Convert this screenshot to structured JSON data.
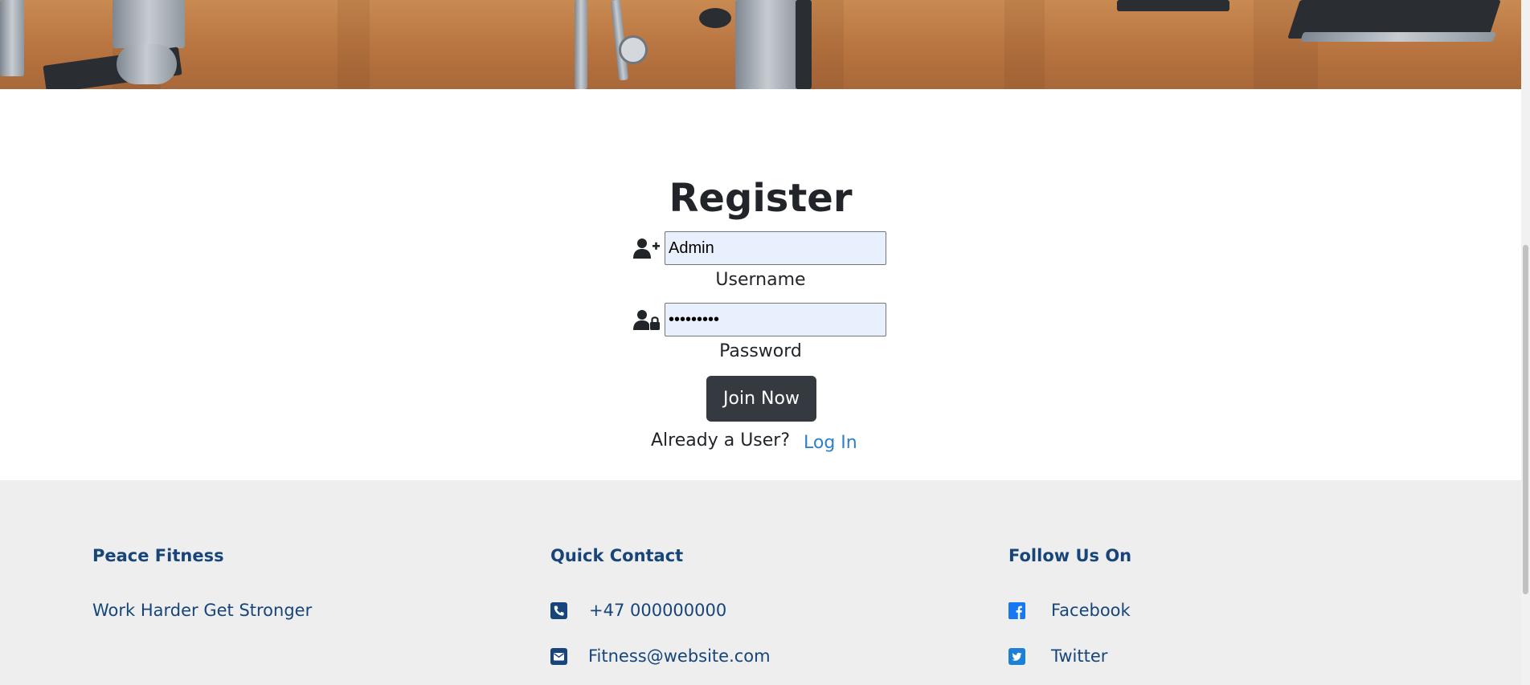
{
  "hero": {
    "icons": [
      "gym-photo-banner"
    ]
  },
  "register": {
    "title": "Register",
    "username": {
      "value": "Admin",
      "label": "Username",
      "icon": "user-plus-icon"
    },
    "password": {
      "value": "123456789",
      "label": "Password",
      "icon": "user-lock-icon"
    },
    "join_button": "Join Now",
    "already_text": "Already a User?",
    "login_link": "Log In"
  },
  "footer": {
    "brand": {
      "heading": "Peace Fitness",
      "tagline": "Work Harder Get Stronger"
    },
    "contact": {
      "heading": "Quick Contact",
      "phone": "+47 000000000",
      "email": "Fitness@website.com",
      "phone_icon": "phone-icon",
      "email_icon": "envelope-icon"
    },
    "social": {
      "heading": "Follow Us On",
      "facebook": "Facebook",
      "twitter": "Twitter",
      "facebook_icon": "facebook-icon",
      "twitter_icon": "twitter-icon"
    }
  },
  "colors": {
    "button_dark": "#343a40",
    "link_blue": "#2f80c8",
    "footer_text": "#17457a",
    "footer_bg": "#eeeeee",
    "input_bg": "#e8f0fe",
    "social_blue": "#1877f2"
  }
}
